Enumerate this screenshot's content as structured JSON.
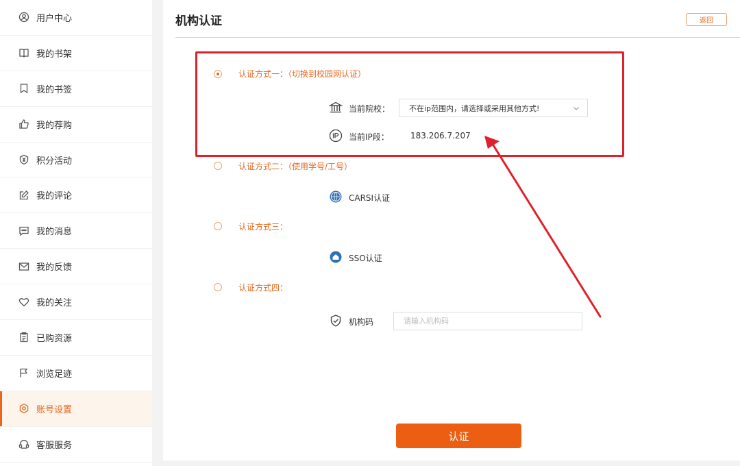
{
  "sidebar": {
    "items": [
      {
        "label": "用户中心",
        "icon": "user-circle-icon"
      },
      {
        "label": "我的书架",
        "icon": "book-open-icon"
      },
      {
        "label": "我的书签",
        "icon": "bookmark-icon"
      },
      {
        "label": "我的荐购",
        "icon": "thumbs-up-icon"
      },
      {
        "label": "积分活动",
        "icon": "yen-badge-icon"
      },
      {
        "label": "我的评论",
        "icon": "edit-icon"
      },
      {
        "label": "我的消息",
        "icon": "message-icon"
      },
      {
        "label": "我的反馈",
        "icon": "mail-icon"
      },
      {
        "label": "我的关注",
        "icon": "heart-icon"
      },
      {
        "label": "已购资源",
        "icon": "clipboard-icon"
      },
      {
        "label": "浏览足迹",
        "icon": "flag-icon"
      },
      {
        "label": "账号设置",
        "icon": "gear-icon",
        "active": true
      },
      {
        "label": "客服服务",
        "icon": "headset-icon"
      }
    ]
  },
  "header": {
    "title": "机构认证",
    "back_label": "返回"
  },
  "methods": {
    "m1": {
      "label": "认证方式一：（切换到校园网认证）",
      "checked": true
    },
    "m2": {
      "label": "认证方式二：（使用学号/工号）",
      "checked": false
    },
    "m3": {
      "label": "认证方式三：",
      "checked": false
    },
    "m4": {
      "label": "认证方式四：",
      "checked": false
    }
  },
  "campus": {
    "school_label": "当前院校：",
    "school_value": "不在ip范围内，请选择或采用其他方式!",
    "ip_label": "当前IP段：",
    "ip_value": "183.206.7.207"
  },
  "carsi": {
    "label": "CARSI认证"
  },
  "sso": {
    "label": "SSO认证"
  },
  "org_code": {
    "label": "机构码",
    "placeholder": "请输入机构码",
    "value": ""
  },
  "submit": {
    "label": "认证"
  },
  "colors": {
    "accent": "#e8681d",
    "button": "#ec5f12",
    "annotation": "#e0202a"
  }
}
